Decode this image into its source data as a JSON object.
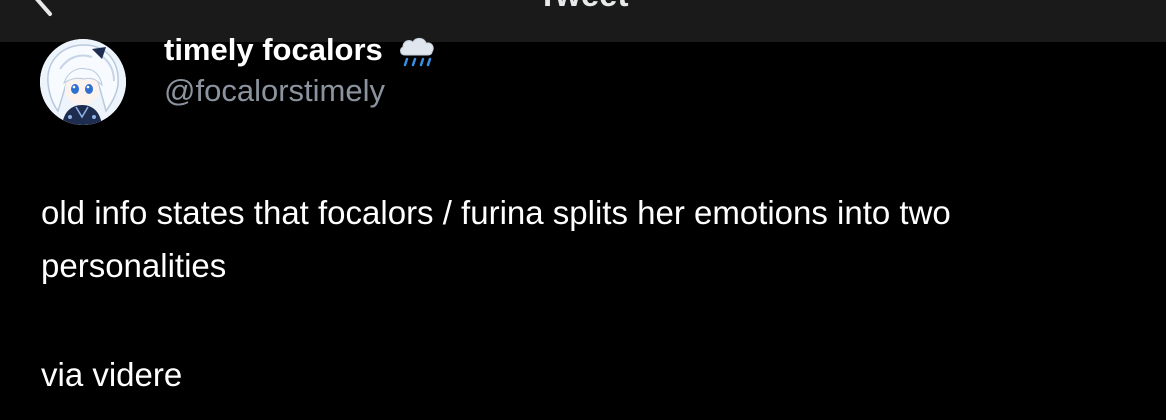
{
  "nav": {
    "title": "Tweet",
    "back_icon": "chevron-left-icon"
  },
  "author": {
    "display_name": "timely focalors",
    "emoji_icon": "cloud-rain-icon",
    "handle": "@focalorstimely"
  },
  "tweet": {
    "line1": "old info states that focalors / furina splits her emotions into two",
    "line2": "personalities",
    "via": "via videre"
  },
  "colors": {
    "background": "#000000",
    "text": "#ffffff",
    "handle": "#8b949e",
    "topbar": "#1a1a1a"
  }
}
